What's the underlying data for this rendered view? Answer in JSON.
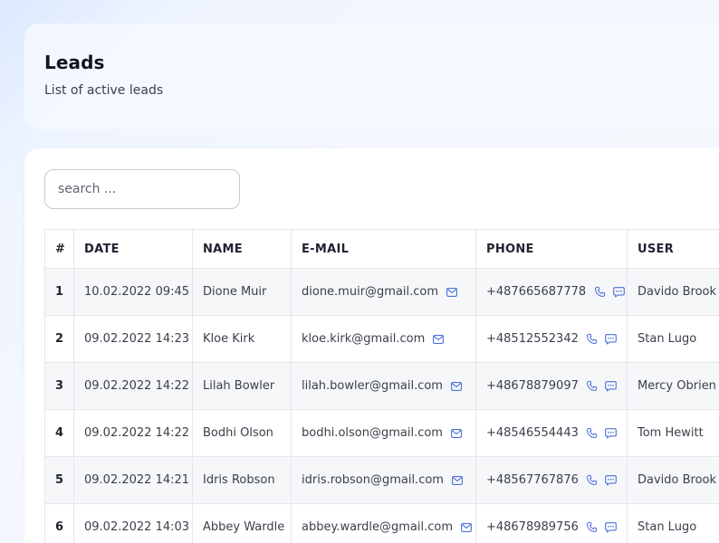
{
  "header": {
    "title": "Leads",
    "subtitle": "List of active leads"
  },
  "search": {
    "placeholder": "search ..."
  },
  "table": {
    "columns": [
      "#",
      "DATE",
      "NAME",
      "E-MAIL",
      "PHONE",
      "USER"
    ],
    "rows": [
      {
        "num": "1",
        "date": "10.02.2022 09:45",
        "name": "Dione Muir",
        "email": "dione.muir@gmail.com",
        "phone": "+487665687778",
        "user": "Davido Brook"
      },
      {
        "num": "2",
        "date": "09.02.2022 14:23",
        "name": "Kloe Kirk",
        "email": "kloe.kirk@gmail.com",
        "phone": "+48512552342",
        "user": "Stan Lugo"
      },
      {
        "num": "3",
        "date": "09.02.2022 14:22",
        "name": "Lilah Bowler",
        "email": "lilah.bowler@gmail.com",
        "phone": "+48678879097",
        "user": "Mercy Obrien"
      },
      {
        "num": "4",
        "date": "09.02.2022 14:22",
        "name": "Bodhi Olson",
        "email": "bodhi.olson@gmail.com",
        "phone": "+48546554443",
        "user": "Tom Hewitt"
      },
      {
        "num": "5",
        "date": "09.02.2022 14:21",
        "name": "Idris Robson",
        "email": "idris.robson@gmail.com",
        "phone": "+48567767876",
        "user": "Davido Brook"
      },
      {
        "num": "6",
        "date": "09.02.2022 14:03",
        "name": "Abbey Wardle",
        "email": "abbey.wardle@gmail.com",
        "phone": "+48678989756",
        "user": "Stan Lugo"
      }
    ]
  },
  "icons": {
    "email": "mail-icon",
    "phone": "phone-icon",
    "message": "chat-icon"
  },
  "colors": {
    "icon_accent": "#4a6fd8",
    "zebra_row": "#f6f7f9"
  }
}
